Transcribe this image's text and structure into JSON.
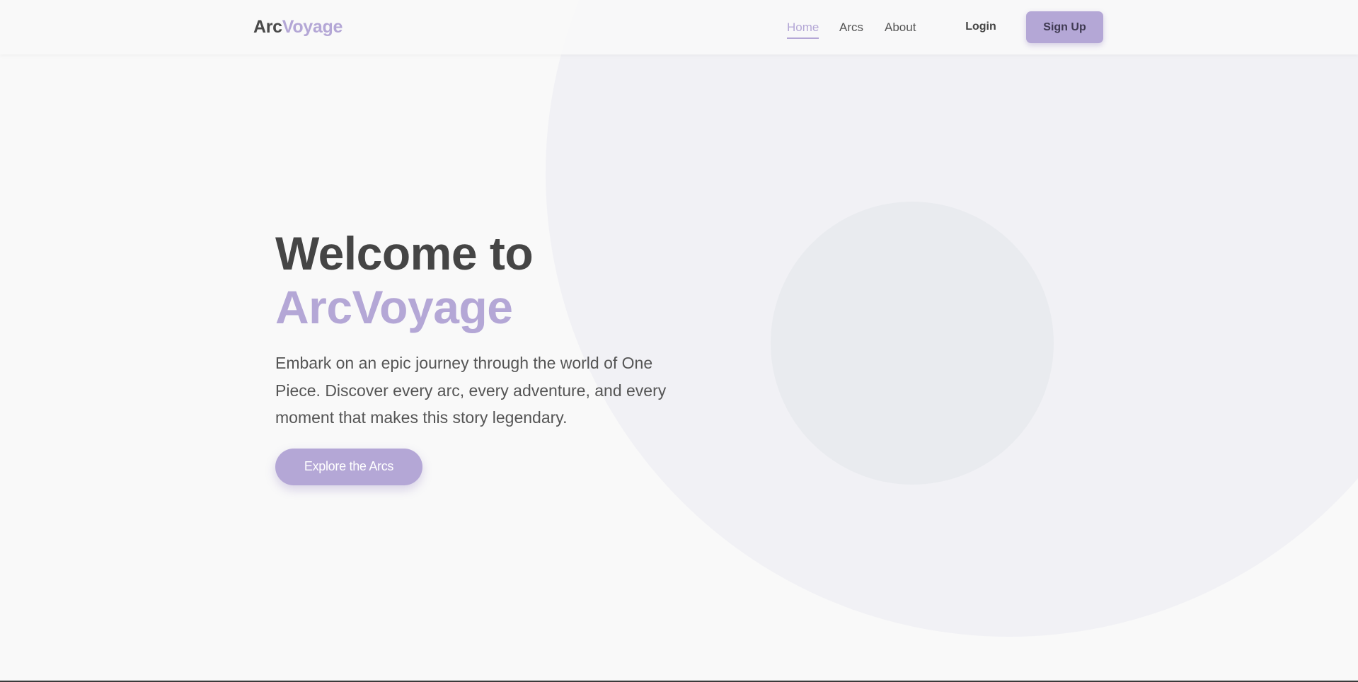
{
  "brand": {
    "part1": "Arc",
    "part2": "Voyage"
  },
  "nav": {
    "links": [
      {
        "label": "Home",
        "active": true
      },
      {
        "label": "Arcs",
        "active": false
      },
      {
        "label": "About",
        "active": false
      }
    ],
    "login_label": "Login",
    "signup_label": "Sign Up"
  },
  "hero": {
    "title_line1": "Welcome to",
    "title_line2": "ArcVoyage",
    "description": "Embark on an epic journey through the world of One Piece. Discover every arc, every adventure, and every moment that makes this story legendary.",
    "cta_label": "Explore the Arcs"
  },
  "colors": {
    "accent": "#b4a7d6",
    "text_dark": "#454545",
    "background": "#f9f9f9"
  }
}
